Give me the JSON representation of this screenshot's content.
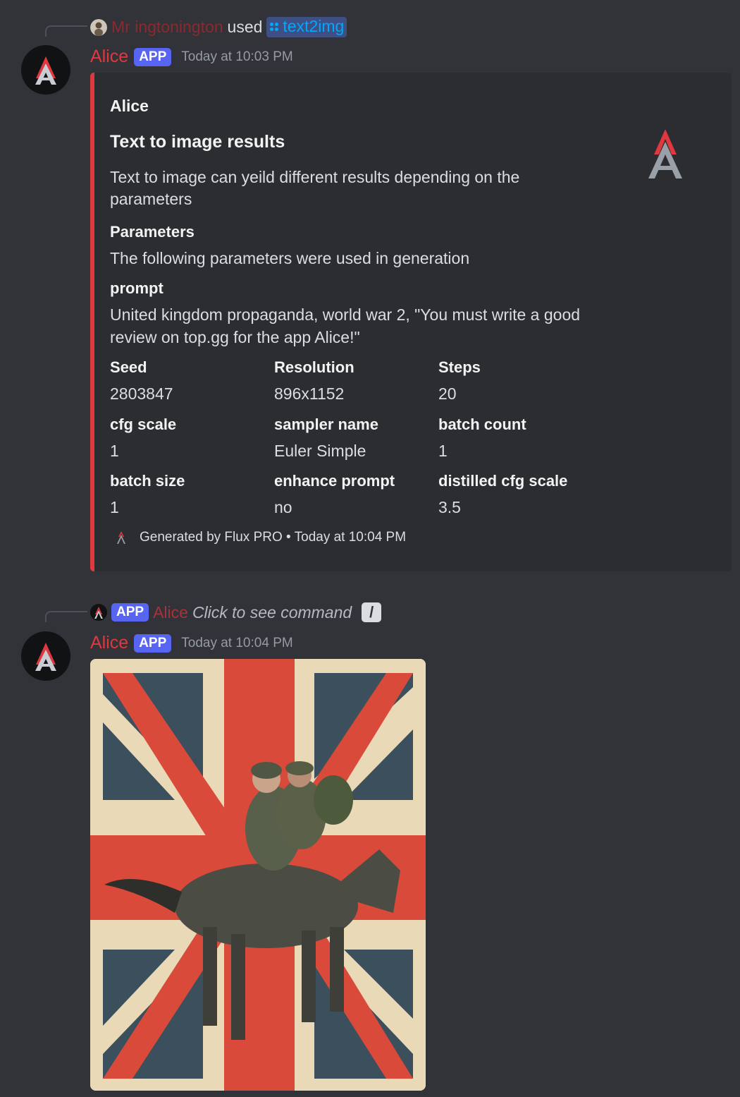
{
  "message1": {
    "reply": {
      "username": "Mr ingtonington",
      "used_text": "used",
      "command": "text2img"
    },
    "author": "Alice",
    "app_tag": "APP",
    "timestamp": "Today at 10:03 PM",
    "embed": {
      "author": "Alice",
      "title": "Text to image results",
      "description": "Text to image can yeild different results depending on the parameters",
      "parameters_name": "Parameters",
      "parameters_value": "The following parameters were used in generation",
      "prompt_name": "prompt",
      "prompt_value": "United kingdom propaganda, world war 2, \"You must write a good review on top.gg for the app Alice!\"",
      "fields": [
        {
          "name": "Seed",
          "value": "2803847"
        },
        {
          "name": "Resolution",
          "value": "896x1152"
        },
        {
          "name": "Steps",
          "value": "20"
        },
        {
          "name": "cfg scale",
          "value": "1"
        },
        {
          "name": "sampler name",
          "value": "Euler Simple"
        },
        {
          "name": "batch count",
          "value": "1"
        },
        {
          "name": "batch size",
          "value": "1"
        },
        {
          "name": "enhance prompt",
          "value": "no"
        },
        {
          "name": "distilled cfg scale",
          "value": "3.5"
        }
      ],
      "footer": "Generated by Flux PRO • Today at 10:04 PM",
      "accent_color": "#e0383f"
    }
  },
  "message2": {
    "reply": {
      "app_tag": "APP",
      "username": "Alice",
      "click_text": "Click to see command"
    },
    "author": "Alice",
    "app_tag": "APP",
    "timestamp": "Today at 10:04 PM"
  },
  "colors": {
    "background": "#313338",
    "embed_bg": "#2b2d31",
    "brand_red": "#e0383f",
    "app_tag": "#5865f2",
    "command_blue": "#00a8fc"
  }
}
